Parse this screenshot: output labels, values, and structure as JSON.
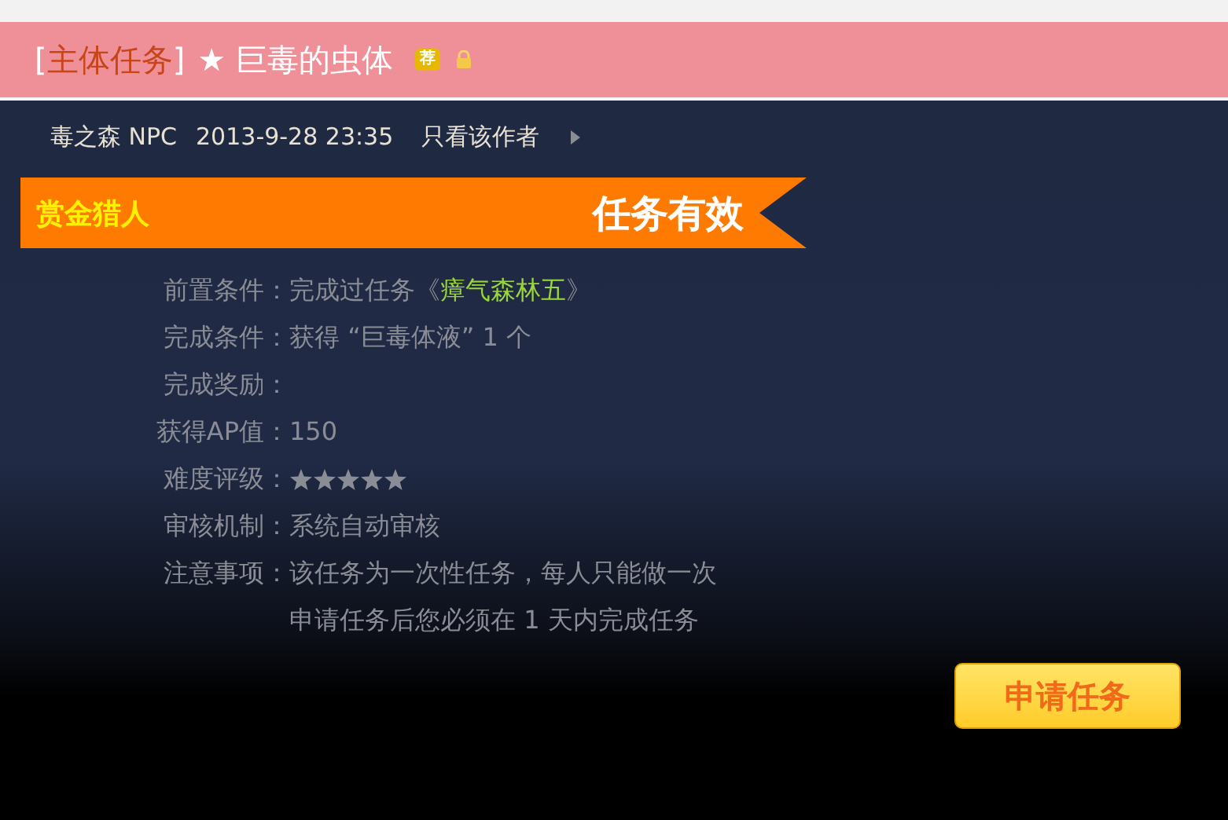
{
  "header": {
    "bracket_open": "[",
    "category": "主体任务",
    "bracket_close": "]",
    "title": "★ 巨毒的虫体",
    "badge": "荐",
    "locked": true
  },
  "post_meta": {
    "author": "毒之森 NPC",
    "date": "2013-9-28 23:35",
    "filter_link": "只看该作者"
  },
  "ribbon": {
    "left": "赏金猎人",
    "right": "任务有效"
  },
  "details": [
    {
      "kind": "link",
      "label": "前置条件：",
      "prefix": "完成过任务《",
      "link": "瘴气森林五",
      "suffix": "》"
    },
    {
      "kind": "text",
      "label": "完成条件：",
      "lines": [
        "获得 “巨毒体液” 1 个"
      ]
    },
    {
      "kind": "text",
      "label": "完成奖励："
    },
    {
      "kind": "text",
      "label": "获得AP值：",
      "lines": [
        "150"
      ]
    },
    {
      "kind": "stars",
      "label": "难度评级：",
      "stars": 5
    },
    {
      "kind": "text",
      "label": "审核机制：",
      "lines": [
        "系统自动审核"
      ]
    },
    {
      "kind": "text",
      "label": "注意事项：",
      "lines": [
        "该任务为一次性任务，每人只能做一次",
        "申请任务后您必须在 1 天内完成任务"
      ]
    }
  ],
  "apply_button": "申请任务"
}
